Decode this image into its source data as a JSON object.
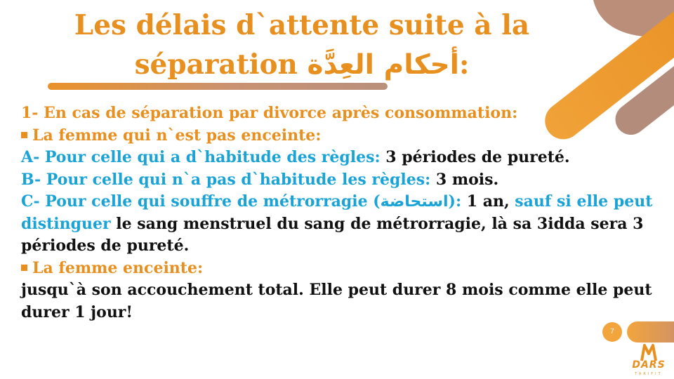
{
  "slide": {
    "title_line1": "Les délais d`attente suite à la",
    "title_line2_fr": "séparation",
    "title_line2_ar": "أحكام العِدَّة",
    "title_line2_colon": ":",
    "heading1": "1- En cas de séparation par divorce après consommation:",
    "bullet1": "La femme qui n`est pas enceinte:",
    "lineA_label": "A- Pour celle qui a d`habitude des règles:",
    "lineA_value": " 3 périodes de pureté.",
    "lineB_label": "B- Pour celle qui n`a pas d`habitude les règles:",
    "lineB_value": " 3 mois.",
    "lineC_label": "C- Pour celle qui souffre de métrorragie (",
    "lineC_ar": "استحاضة",
    "lineC_close": "):",
    "lineC_value": " 1 an,",
    "lineC_blue2": " sauf si elle peut distinguer",
    "lineC_rest": " le sang menstruel du sang de métrorragie, là sa 3idda sera 3 périodes de pureté.",
    "bullet2": "La femme enceinte:",
    "final_text": "jusqu`à son accouchement total. Elle peut durer 8 mois comme elle peut durer 1 jour!",
    "page_number": "7"
  },
  "logo": {
    "text": "DARS",
    "subtext": "TARIFIT"
  },
  "colors": {
    "orange": "#e8901f",
    "blue": "#1aa3d6",
    "mauve": "#b9907c"
  }
}
